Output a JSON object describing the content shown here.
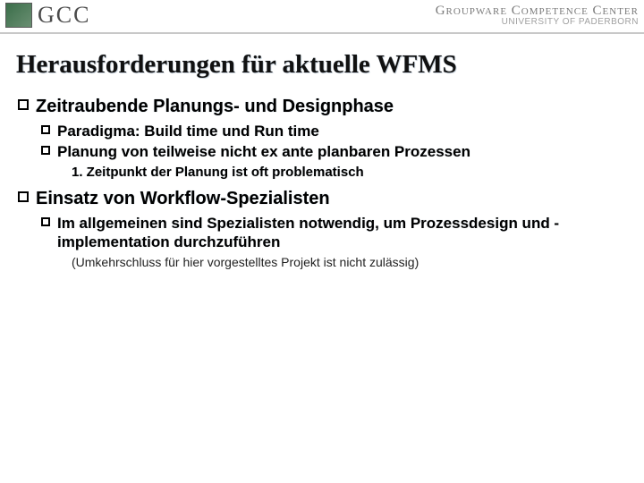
{
  "header": {
    "brand_short": "GCC",
    "brand_long": "Groupware Competence Center",
    "university": "UNIVERSITY OF PADERBORN"
  },
  "title": "Herausforderungen für aktuelle WFMS",
  "sections": [
    {
      "text": "Zeitraubende Planungs- und Designphase",
      "children": [
        {
          "text": "Paradigma: Build time und Run time"
        },
        {
          "text": "Planung von teilweise nicht ex ante planbaren Prozessen",
          "numbered": [
            "1. Zeitpunkt der Planung ist oft problematisch"
          ]
        }
      ]
    },
    {
      "text": "Einsatz von Workflow-Spezialisten",
      "children": [
        {
          "text": "Im allgemeinen sind Spezialisten notwendig, um Prozessdesign und -implementation durchzuführen",
          "note": "(Umkehrschluss für hier vorgestelltes Projekt ist nicht zulässig)"
        }
      ]
    }
  ]
}
